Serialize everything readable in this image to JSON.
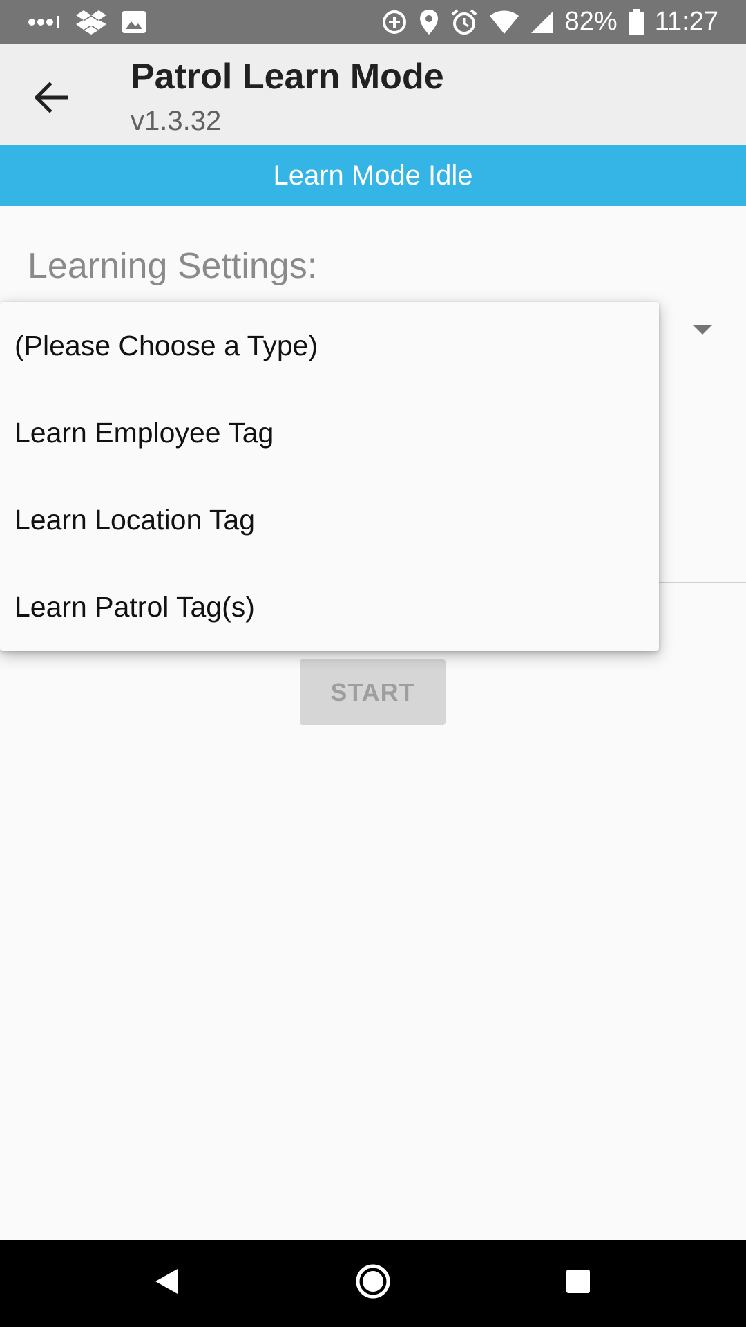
{
  "status_bar": {
    "icons": [
      "signal-dots-icon",
      "dropbox-icon",
      "image-icon",
      "data-saver-icon",
      "location-icon",
      "alarm-icon",
      "wifi-icon",
      "cell-signal-icon",
      "battery-icon"
    ],
    "battery_text": "82%",
    "time": "11:27"
  },
  "app_bar": {
    "title": "Patrol Learn Mode",
    "subtitle": "v1.3.32",
    "back_icon": "arrow-back-icon"
  },
  "status_banner": {
    "text": "Learn Mode Idle",
    "color": "#35b5e5"
  },
  "settings": {
    "label": "Learning Settings:"
  },
  "dropdown": {
    "options": [
      "(Please Choose a Type)",
      "Learn Employee Tag",
      "Learn Location Tag",
      "Learn Patrol Tag(s)"
    ]
  },
  "start_button": {
    "label": "START"
  },
  "nav_bar": {
    "icons": [
      "nav-back-icon",
      "nav-home-icon",
      "nav-recents-icon"
    ]
  }
}
